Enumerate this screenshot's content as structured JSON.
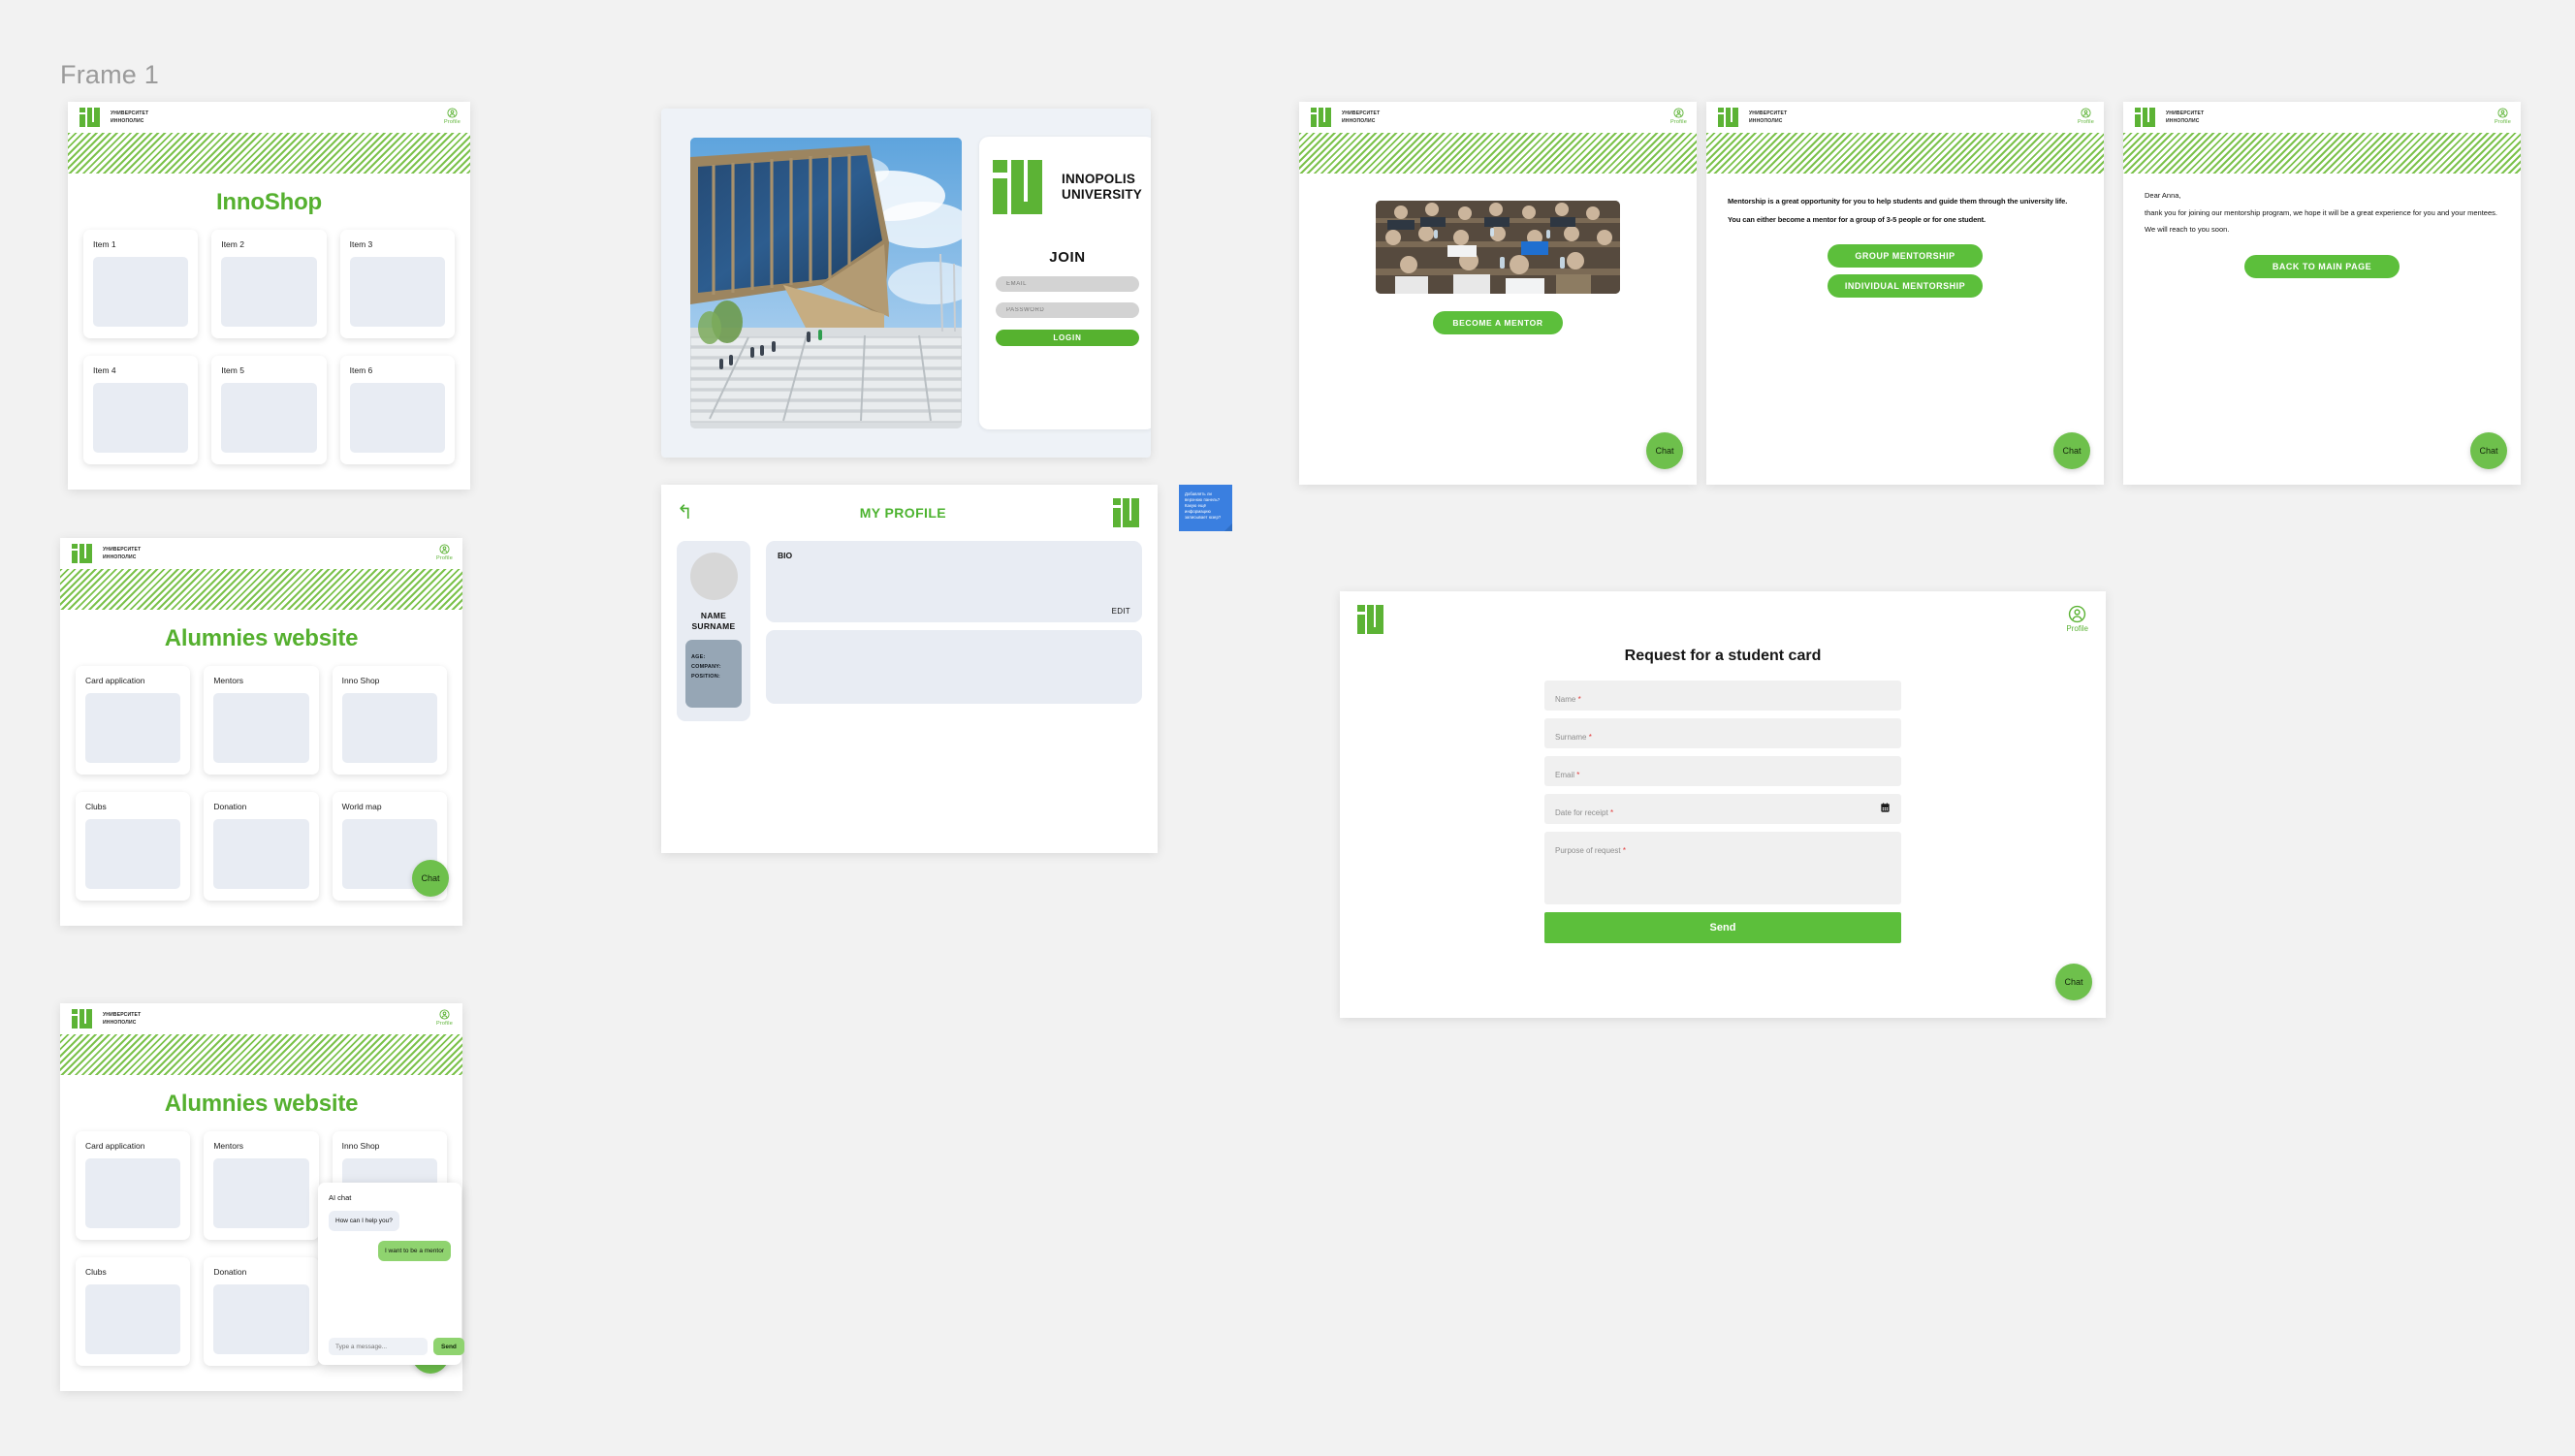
{
  "frame": {
    "title": "Frame 1"
  },
  "brand": {
    "logo_icon": "iu-logo-icon",
    "wordmark_ru": "УНИВЕРСИТЕТ\nИННОПОЛИС",
    "name_en": "INNOPOLIS\nUNIVERSITY",
    "green": "#5cb335",
    "heading_green": "#55b02f",
    "button_green": "#5cbf3b"
  },
  "header": {
    "profile_label": "Profile",
    "profile_icon": "user-circle-icon"
  },
  "chat_fab": {
    "label": "Chat",
    "icon": "chat-bubble-icon"
  },
  "innoshop": {
    "heading": "InnoShop",
    "items": [
      {
        "title": "Item 1"
      },
      {
        "title": "Item 2"
      },
      {
        "title": "Item 3"
      },
      {
        "title": "Item 4"
      },
      {
        "title": "Item 5"
      },
      {
        "title": "Item 6"
      }
    ]
  },
  "alumnies": {
    "heading": "Alumnies website",
    "cards": [
      {
        "title": "Card application"
      },
      {
        "title": "Mentors"
      },
      {
        "title": "Inno Shop"
      },
      {
        "title": "Clubs"
      },
      {
        "title": "Donation"
      },
      {
        "title": "World map"
      }
    ]
  },
  "alumnies_chat": {
    "heading": "Alumnies website",
    "cards": [
      {
        "title": "Card application"
      },
      {
        "title": "Mentors"
      },
      {
        "title": "Inno Shop"
      },
      {
        "title": "Clubs"
      },
      {
        "title": "Donation"
      }
    ]
  },
  "login": {
    "brand_name": "INNOPOLIS\nUNIVERSITY",
    "join_title": "JOIN",
    "email_placeholder": "EMAIL",
    "email_value": "",
    "password_placeholder": "PASSWORD",
    "password_value": "",
    "login_button": "LOGIN",
    "photo_alt": "innopolis-university-building-photo"
  },
  "profile": {
    "title": "MY PROFILE",
    "back_icon": "back-arrow-icon",
    "logo_icon": "iu-logo-icon",
    "avatar_icon": "avatar-placeholder",
    "name": "NAME\nSURNAME",
    "info": "AGE:\nCOMPANY:\nPOSITION:",
    "bio_label": "BIO",
    "bio_value": "",
    "edit_label": "EDIT"
  },
  "sticky_note": {
    "text": "Добавлять ли\nверхнюю панель?\nКакую ещё\nинформацию\nзаписывает юзер?",
    "color": "#3a7fe0"
  },
  "mentor_intro": {
    "photo_alt": "students-in-lecture-hall-photo",
    "cta": "BECOME A MENTOR"
  },
  "mentor_choice": {
    "paragraph_1": "Mentorship is a great opportunity for you to help students and guide them through the university life.",
    "paragraph_2": "You can either become a mentor for a group of 3-5 people or for one student.",
    "group_button": "GROUP MENTORSHIP",
    "individual_button": "INDIVIDUAL MENTORSHIP"
  },
  "mentor_thanks": {
    "greeting": "Dear Anna,",
    "body": "thank you for joining our mentorship program, we hope it will be a great experience for you and your mentees.",
    "closing": "We will reach to you soon.",
    "back_button": "BACK TO MAIN PAGE"
  },
  "student_card_form": {
    "title": "Request for a student card",
    "fields": [
      {
        "label": "Name",
        "required": "*",
        "value": "",
        "type": "text"
      },
      {
        "label": "Surname",
        "required": "*",
        "value": "",
        "type": "text"
      },
      {
        "label": "Email",
        "required": "*",
        "value": "",
        "type": "text"
      },
      {
        "label": "Date for receipt",
        "required": "*",
        "value": "",
        "type": "date",
        "icon": "calendar-icon"
      },
      {
        "label": "Purpose of request",
        "required": "*",
        "value": "",
        "type": "textarea"
      }
    ],
    "submit": "Send",
    "profile_label": "Profile"
  },
  "ai_chat": {
    "title": "AI chat",
    "messages": [
      {
        "from": "bot",
        "text": "How can I help you?"
      },
      {
        "from": "user",
        "text": "I want to be a mentor"
      }
    ],
    "input_placeholder": "Type a message...",
    "input_value": "",
    "send_label": "Send"
  }
}
